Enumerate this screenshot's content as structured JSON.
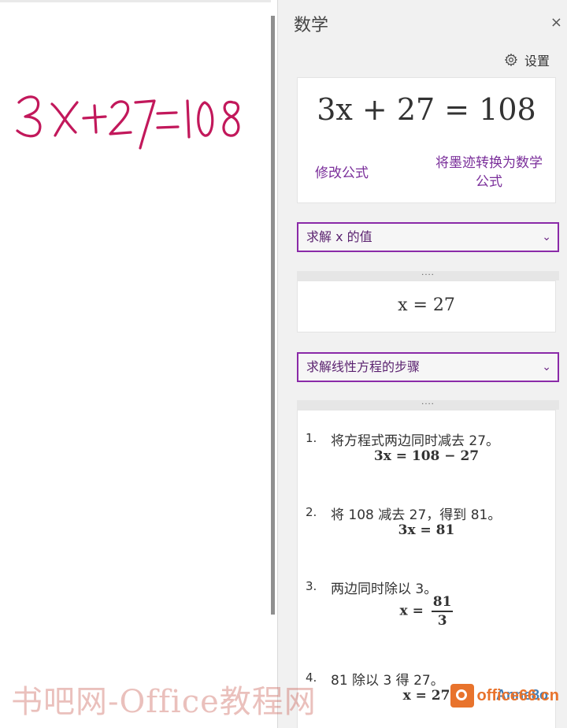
{
  "canvas": {
    "handwriting": "3x+27=108",
    "ink_color": "#c2185b"
  },
  "pane": {
    "title": "数学",
    "close_label": "×",
    "settings_label": "设置"
  },
  "equation": {
    "display": "3x + 27 = 108",
    "edit_link": "修改公式",
    "convert_link": "将墨迹转换为数学公式"
  },
  "action_dropdown": {
    "selected": "求解 x 的值",
    "chevron": "⌄"
  },
  "result": {
    "handle": "....",
    "value": "x = 27"
  },
  "steps_dropdown": {
    "selected": "求解线性方程的步骤",
    "chevron": "⌄"
  },
  "steps": {
    "handle": "....",
    "items": [
      {
        "num": "1.",
        "text": "将方程式两边同时减去 27。",
        "math": "3x = 108 − 27"
      },
      {
        "num": "2.",
        "text": "将 108 减去 27，得到 81。",
        "math": "3x = 81"
      },
      {
        "num": "3.",
        "text": "两边同时除以 3。",
        "math_lhs": "x =",
        "frac_num": "81",
        "frac_den": "3"
      },
      {
        "num": "4.",
        "text": "81 除以 3 得 27。",
        "math": "x = 27"
      }
    ]
  },
  "watermarks": {
    "left": "书吧网-Office教程网",
    "right_text": "office66.cn",
    "right_top": "Anne8o"
  },
  "colors": {
    "accent": "#8a2aa8",
    "link": "#7a2e9a",
    "pane_bg": "#f1f1f1"
  }
}
